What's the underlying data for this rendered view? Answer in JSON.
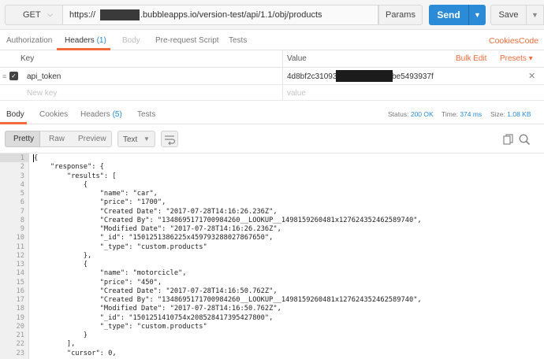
{
  "request": {
    "method": "GET",
    "url_prefix": "https://",
    "url_suffix": ".bubbleapps.io/version-test/api/1.1/obj/products",
    "params_label": "Params",
    "send_label": "Send",
    "save_label": "Save"
  },
  "request_tabs": {
    "authorization": "Authorization",
    "headers": "Headers",
    "headers_count": "(1)",
    "body": "Body",
    "prerequest": "Pre-request Script",
    "tests": "Tests",
    "cookies_link": "Cookies",
    "code_link": "Code"
  },
  "headers_table": {
    "key_header": "Key",
    "value_header": "Value",
    "bulk_edit": "Bulk Edit",
    "presets": "Presets ▾",
    "rows": [
      {
        "key": "api_token",
        "value_prefix": "4d8bf2c31093C",
        "value_suffix": "be5493937f"
      }
    ],
    "new_key_placeholder": "New key",
    "new_value_placeholder": "value"
  },
  "response_tabs": {
    "body": "Body",
    "cookies": "Cookies",
    "headers": "Headers",
    "headers_count": "(5)",
    "tests": "Tests"
  },
  "status": {
    "status_label": "Status:",
    "status_value": "200 OK",
    "time_label": "Time:",
    "time_value": "374 ms",
    "size_label": "Size:",
    "size_value": "1.08 KB"
  },
  "toolbar": {
    "pretty": "Pretty",
    "raw": "Raw",
    "preview": "Preview",
    "type": "Text",
    "wrap_icon": "wrap-lines-icon",
    "copy_icon": "copy-icon",
    "search_icon": "search-icon"
  },
  "code_lines": [
    "{",
    "    \"response\": {",
    "        \"results\": [",
    "            {",
    "                \"name\": \"car\",",
    "                \"price\": \"1700\",",
    "                \"Created Date\": \"2017-07-28T14:16:26.236Z\",",
    "                \"Created By\": \"1348695171700984260__LOOKUP__1498159260481x127624352462589740\",",
    "                \"Modified Date\": \"2017-07-28T14:16:26.236Z\",",
    "                \"_id\": \"1501251386225x459793288027867650\",",
    "                \"_type\": \"custom.products\"",
    "            },",
    "            {",
    "                \"name\": \"motorcicle\",",
    "                \"price\": \"450\",",
    "                \"Created Date\": \"2017-07-28T14:16:50.762Z\",",
    "                \"Created By\": \"1348695171700984260__LOOKUP__1498159260481x127624352462589740\",",
    "                \"Modified Date\": \"2017-07-28T14:16:50.762Z\",",
    "                \"_id\": \"1501251410754x208528417395427800\",",
    "                \"_type\": \"custom.products\"",
    "            }",
    "        ],",
    "        \"cursor\": 0,"
  ],
  "colors": {
    "accent_orange": "#f26b3a",
    "send_blue": "#2b8bd6",
    "status_blue": "#2b8bd6"
  }
}
